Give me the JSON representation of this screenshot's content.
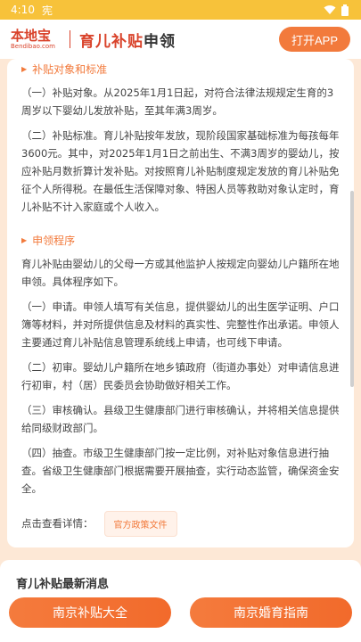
{
  "status": {
    "time": "4:10",
    "carrier_icon": "宪"
  },
  "header": {
    "logo_brand": "本地宝",
    "logo_domain": "Bendibao.com",
    "title_a": "育儿补贴",
    "title_b": "申领",
    "open_app": "打开APP"
  },
  "content": {
    "s1_title": "补贴对象和标准",
    "p1": "（一）补贴对象。从2025年1月1日起，对符合法律法规规定生育的3周岁以下婴幼儿发放补贴，至其年满3周岁。",
    "p2": "（二）补贴标准。育儿补贴按年发放，现阶段国家基础标准为每孩每年3600元。其中，对2025年1月1日之前出生、不满3周岁的婴幼儿，按应补贴月数折算计发补贴。对按照育儿补贴制度规定发放的育儿补贴免征个人所得税。在最低生活保障对象、特困人员等救助对象认定时，育儿补贴不计入家庭或个人收入。",
    "s2_title": "申领程序",
    "p3": "育儿补贴由婴幼儿的父母一方或其他监护人按规定向婴幼儿户籍所在地申领。具体程序如下。",
    "p4": "（一）申请。申领人填写有关信息，提供婴幼儿的出生医学证明、户口簿等材料，并对所提供信息及材料的真实性、完整性作出承诺。申领人主要通过育儿补贴信息管理系统线上申请，也可线下申请。",
    "p5": "（二）初审。婴幼儿户籍所在地乡镇政府（街道办事处）对申请信息进行初审，村（居）民委员会协助做好相关工作。",
    "p6": "（三）审核确认。县级卫生健康部门进行审核确认，并将相关信息提供给同级财政部门。",
    "p7": "（四）抽查。市级卫生健康部门按一定比例，对补贴对象信息进行抽查。省级卫生健康部门根据需要开展抽查，实行动态监管，确保资金安全。",
    "detail_label": "点击查看详情：",
    "policy_link": "官方政策文件"
  },
  "news": {
    "title": "育儿补贴最新消息"
  },
  "buttons": {
    "left": "南京补贴大全",
    "right": "南京婚育指南"
  },
  "colors": {
    "accent": "#f27a3c",
    "brand": "#d9432b",
    "status": "#f7c23a"
  }
}
